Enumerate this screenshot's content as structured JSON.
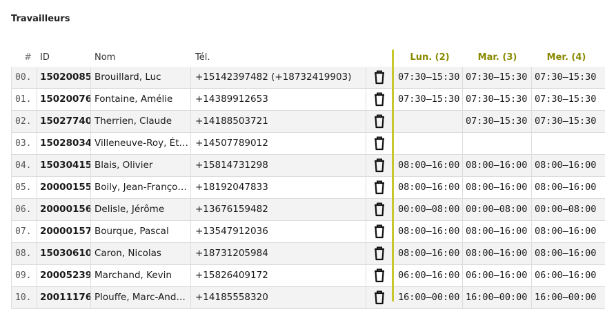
{
  "section_title": "Travailleurs",
  "columns": {
    "num": "#",
    "id": "ID",
    "name": "Nom",
    "tel": "Tél.",
    "days": [
      "Lun. (2)",
      "Mar. (3)",
      "Mer. (4)"
    ]
  },
  "colors": {
    "accent": "#c8c82c",
    "day_header": "#8a8a00"
  },
  "icons": {
    "delete": "trash-icon"
  },
  "rows": [
    {
      "num": "00.",
      "id": "15020085",
      "name": "Brouillard, Luc",
      "tel": "+15142397482  (+18732419903)",
      "shifts": [
        "07:30–15:30",
        "07:30–15:30",
        "07:30–15:30"
      ]
    },
    {
      "num": "01.",
      "id": "15020076",
      "name": "Fontaine, Amélie",
      "tel": "+14389912653",
      "shifts": [
        "07:30–15:30",
        "07:30–15:30",
        "07:30–15:30"
      ]
    },
    {
      "num": "02.",
      "id": "15027740",
      "name": "Therrien, Claude",
      "tel": "+14188503721",
      "shifts": [
        "",
        "07:30–15:30",
        "07:30–15:30"
      ]
    },
    {
      "num": "03.",
      "id": "15028034",
      "name": "Villeneuve-Roy, Ét…",
      "tel": "+14507789012",
      "shifts": [
        "",
        "",
        ""
      ]
    },
    {
      "num": "04.",
      "id": "15030415",
      "name": "Blais, Olivier",
      "tel": "+15814731298",
      "shifts": [
        "08:00–16:00",
        "08:00–16:00",
        "08:00–16:00"
      ]
    },
    {
      "num": "05.",
      "id": "20000155",
      "name": "Boily, Jean-Franço…",
      "tel": "+18192047833",
      "shifts": [
        "08:00–16:00",
        "08:00–16:00",
        "08:00–16:00"
      ]
    },
    {
      "num": "06.",
      "id": "20000156",
      "name": "Delisle, Jérôme",
      "tel": "+13676159482",
      "shifts": [
        "00:00–08:00",
        "00:00–08:00",
        "00:00–08:00"
      ]
    },
    {
      "num": "07.",
      "id": "20000157",
      "name": "Bourque, Pascal",
      "tel": "+13547912036",
      "shifts": [
        "08:00–16:00",
        "08:00–16:00",
        "08:00–16:00"
      ]
    },
    {
      "num": "08.",
      "id": "15030610",
      "name": "Caron, Nicolas",
      "tel": "+18731205984",
      "shifts": [
        "08:00–16:00",
        "08:00–16:00",
        "08:00–16:00"
      ]
    },
    {
      "num": "09.",
      "id": "20005239",
      "name": "Marchand, Kevin",
      "tel": "+15826409172",
      "shifts": [
        "06:00–16:00",
        "06:00–16:00",
        "06:00–16:00"
      ]
    },
    {
      "num": "10.",
      "id": "20011176",
      "name": "Plouffe, Marc-And…",
      "tel": "+14185558320",
      "shifts": [
        "16:00–00:00",
        "16:00–00:00",
        "16:00–00:00"
      ]
    }
  ]
}
